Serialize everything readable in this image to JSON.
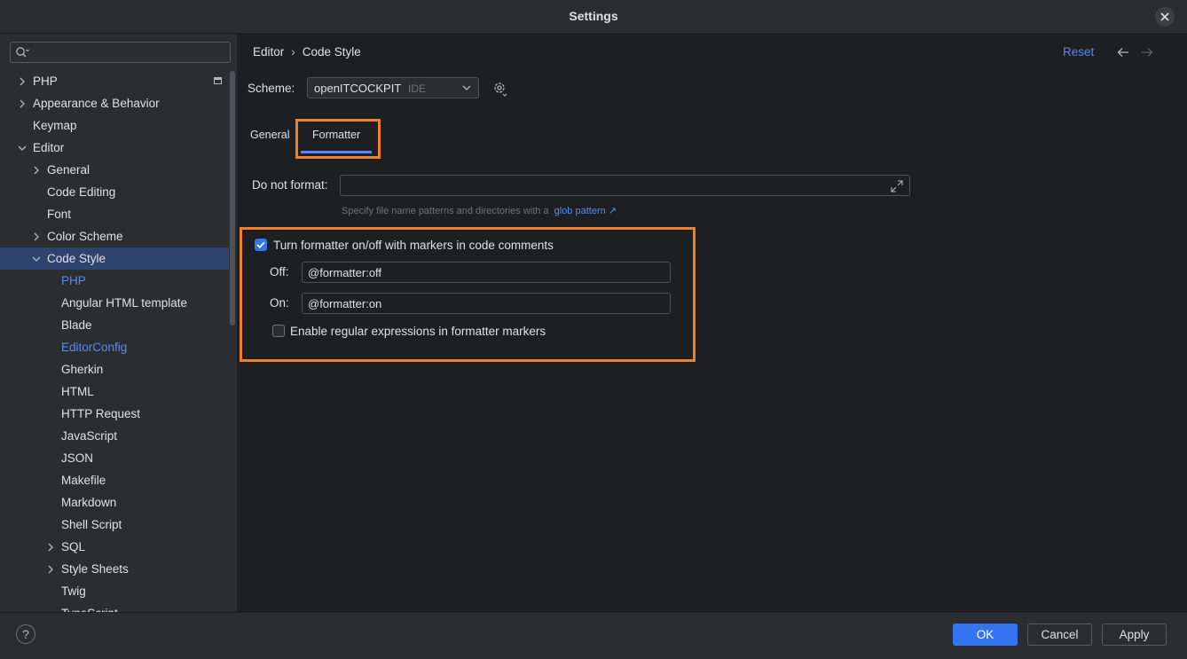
{
  "window": {
    "title": "Settings"
  },
  "search": {
    "value": "",
    "placeholder": ""
  },
  "sidebar": {
    "items": [
      {
        "label": "PHP",
        "level": 0,
        "chevron": "right",
        "page_icon": true
      },
      {
        "label": "Appearance & Behavior",
        "level": 0,
        "chevron": "right"
      },
      {
        "label": "Keymap",
        "level": 0,
        "chevron": "none"
      },
      {
        "label": "Editor",
        "level": 0,
        "chevron": "down"
      },
      {
        "label": "General",
        "level": 1,
        "chevron": "right"
      },
      {
        "label": "Code Editing",
        "level": 1,
        "chevron": "none"
      },
      {
        "label": "Font",
        "level": 1,
        "chevron": "none"
      },
      {
        "label": "Color Scheme",
        "level": 1,
        "chevron": "right"
      },
      {
        "label": "Code Style",
        "level": 1,
        "chevron": "down",
        "selected": true
      },
      {
        "label": "PHP",
        "level": 2,
        "chevron": "none",
        "link": true
      },
      {
        "label": "Angular HTML template",
        "level": 2,
        "chevron": "none"
      },
      {
        "label": "Blade",
        "level": 2,
        "chevron": "none"
      },
      {
        "label": "EditorConfig",
        "level": 2,
        "chevron": "none",
        "link": true
      },
      {
        "label": "Gherkin",
        "level": 2,
        "chevron": "none"
      },
      {
        "label": "HTML",
        "level": 2,
        "chevron": "none"
      },
      {
        "label": "HTTP Request",
        "level": 2,
        "chevron": "none"
      },
      {
        "label": "JavaScript",
        "level": 2,
        "chevron": "none"
      },
      {
        "label": "JSON",
        "level": 2,
        "chevron": "none"
      },
      {
        "label": "Makefile",
        "level": 2,
        "chevron": "none"
      },
      {
        "label": "Markdown",
        "level": 2,
        "chevron": "none"
      },
      {
        "label": "Shell Script",
        "level": 2,
        "chevron": "none"
      },
      {
        "label": "SQL",
        "level": 2,
        "chevron": "right"
      },
      {
        "label": "Style Sheets",
        "level": 2,
        "chevron": "right"
      },
      {
        "label": "Twig",
        "level": 2,
        "chevron": "none"
      },
      {
        "label": "TypeScript",
        "level": 2,
        "chevron": "none"
      }
    ]
  },
  "breadcrumb": {
    "parent": "Editor",
    "separator": "›",
    "current": "Code Style"
  },
  "header": {
    "reset_label": "Reset"
  },
  "scheme": {
    "label": "Scheme:",
    "value": "openITCOCKPIT",
    "sub": "IDE"
  },
  "tabs": [
    {
      "label": "General",
      "active": false
    },
    {
      "label": "Formatter",
      "active": true
    }
  ],
  "formatter": {
    "do_not_format_label": "Do not format:",
    "do_not_format_value": "",
    "hint_text": "Specify file name patterns and directories with a",
    "hint_link": "glob pattern ↗",
    "markers_checkbox_label": "Turn formatter on/off with markers in code comments",
    "markers_checked": true,
    "off_label": "Off:",
    "off_value": "@formatter:off",
    "on_label": "On:",
    "on_value": "@formatter:on",
    "regex_checkbox_label": "Enable regular expressions in formatter markers",
    "regex_checked": false
  },
  "footer": {
    "help_label": "?",
    "ok_label": "OK",
    "cancel_label": "Cancel",
    "apply_label": "Apply"
  },
  "colors": {
    "accent": "#3574f0",
    "link": "#548af7",
    "highlight": "#f0802a",
    "selection": "#2e436e",
    "panel": "#2b2d30",
    "background": "#1e1f22"
  },
  "icons": {
    "search": "search-icon",
    "close": "close-icon",
    "gear": "gear-icon",
    "back": "arrow-left-icon",
    "forward": "arrow-right-icon",
    "expand": "expand-icon"
  }
}
